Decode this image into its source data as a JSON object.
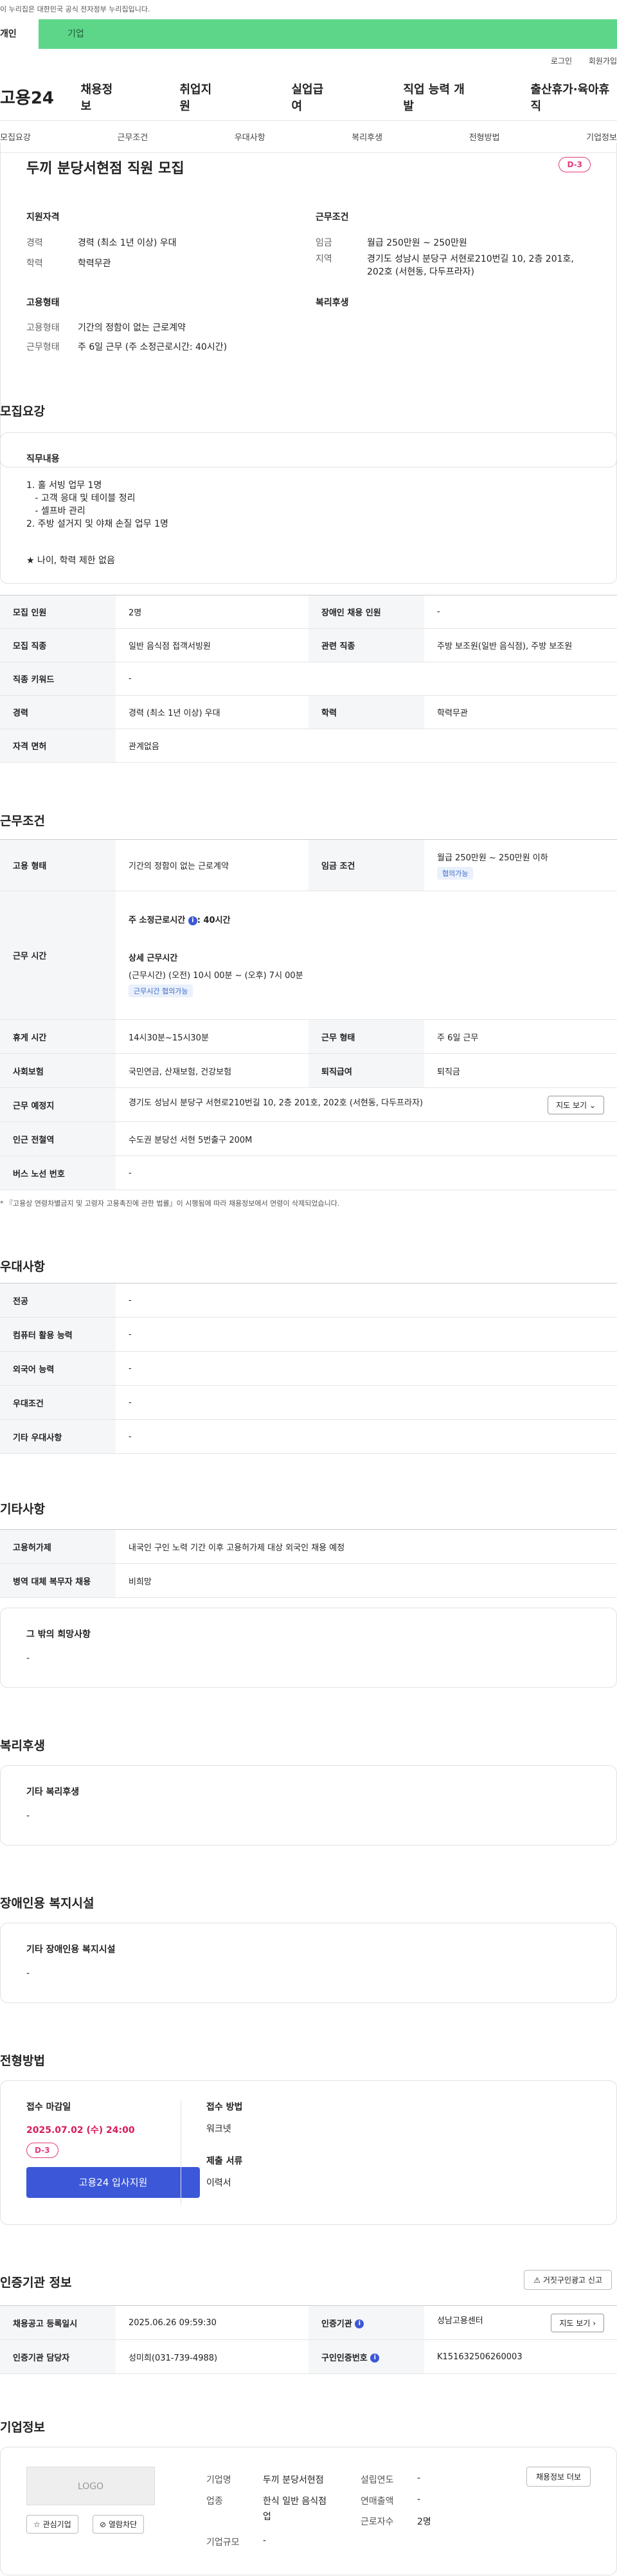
{
  "gov_banner": "이 누리집은 대한민국 공식 전자정부 누리집입니다.",
  "tabs": {
    "personal": "개인",
    "company": "기업"
  },
  "util": {
    "login": "로그인",
    "join": "회원가입"
  },
  "gnb": {
    "logo": "고용24",
    "items": [
      "채용정보",
      "취업지원",
      "실업급여",
      "직업 능력 개발",
      "출산휴가·육아휴직"
    ]
  },
  "subnav": [
    "모집요강",
    "근무조건",
    "우대사항",
    "복리후생",
    "전형방법",
    "기업정보"
  ],
  "job": {
    "title": "두끼 분당서현점 직원 모집",
    "dday": "D-3",
    "qual_head": "지원자격",
    "career_k": "경력",
    "career_v": "경력 (최소 1년 이상) 우대",
    "edu_k": "학력",
    "edu_v": "학력무관",
    "cond_head": "근무조건",
    "wage_k": "임금",
    "wage_v": "월급 250만원 ~ 250만원",
    "region_k": "지역",
    "region_v1": "경기도 성남시 분당구 서현로210번길 10, 2층 201호,",
    "region_v2": "202호 (서현동, 다두프라자)",
    "emp_head": "고용형태",
    "emp_k": "고용형태",
    "emp_v": "기간의 정함이 없는 근로계약",
    "work_k": "근무형태",
    "work_v": "주 6일 근무 (주 소정근로시간: 40시간)",
    "welfare_head": "복리후생"
  },
  "recruit": {
    "title": "모집요강",
    "duty_head": "직무내용",
    "duty_lines": [
      "1. 홀 서빙 업무 1명",
      "   - 고객 응대 및 테이블 정리",
      "   - 셀프바 관리",
      "2. 주방 설거지 및 야채 손질 업무 1명"
    ],
    "duty_note": "★ 나이, 학력 제한 없음",
    "rows": [
      {
        "k1": "모집 인원",
        "v1": "2명",
        "k2": "장애인 채용 인원",
        "v2": "-"
      },
      {
        "k1": "모집 직종",
        "v1": "일반 음식점 접객서빙원",
        "k2": "관련 직종",
        "v2": "주방 보조원(일반 음식점), 주방 보조원"
      },
      {
        "k1": "직종 키워드",
        "v1": "-"
      },
      {
        "k1": "경력",
        "v1": "경력 (최소 1년 이상) 우대",
        "k2": "학력",
        "v2": "학력무관"
      },
      {
        "k1": "자격 면허",
        "v1": "관계없음"
      }
    ]
  },
  "conditions": {
    "title": "근무조건",
    "emp_k": "고용 형태",
    "emp_v": "기간의 정함이 없는 근로계약",
    "wage_k": "임금 조건",
    "wage_v": "월급 250만원 ~ 250만원 이하",
    "wage_chip": "협의가능",
    "time_k": "근무 시간",
    "time_weekly": "주 소정근로시간 ",
    "time_weekly_v": ": 40시간",
    "time_detail_head": "상세 근무시간",
    "time_detail": "(근무시간) (오전) 10시 00분 ~ (오후) 7시 00분",
    "time_chip": "근무시간 협의가능",
    "rest_k": "휴게 시간",
    "rest_v": "14시30분~15시30분",
    "form_k": "근무 형태",
    "form_v": "주 6일 근무",
    "ins_k": "사회보험",
    "ins_v": "국민연금, 산재보험, 건강보험",
    "sev_k": "퇴직급여",
    "sev_v": "퇴직금",
    "place_k": "근무 예정지",
    "place_v": "경기도 성남시 분당구 서현로210번길 10, 2층 201호, 202호 (서현동, 다두프라자)",
    "map_btn": "지도 보기",
    "subway_k": "인근 전철역",
    "subway_v": "수도권 분당선 서현 5번출구 200M",
    "bus_k": "버스 노선 번호",
    "bus_v": "-",
    "note": "* 『고용상 연령차별금지 및 고령자 고용촉진에 관한 법률』이 시행됨에 따라 채용정보에서 연령이 삭제되었습니다."
  },
  "prefer": {
    "title": "우대사항",
    "rows": [
      {
        "k": "전공",
        "v": "-"
      },
      {
        "k": "컴퓨터 활용 능력",
        "v": "-"
      },
      {
        "k": "외국어 능력",
        "v": "-"
      },
      {
        "k": "우대조건",
        "v": "-"
      },
      {
        "k": "기타 우대사항",
        "v": "-"
      }
    ]
  },
  "etc": {
    "title": "기타사항",
    "hire_k": "고용허가제",
    "hire_v": "내국인 구인 노력 기간 이후 고용허가제 대상 외국인 채용 예정",
    "mil_k": "병역 대체 복무자 채용",
    "mil_v": "비희망",
    "other_head": "그 밖의 희망사항",
    "other_v": "-"
  },
  "welfare": {
    "title": "복리후생",
    "head": "기타 복리후생",
    "v": "-"
  },
  "disabled": {
    "title": "장애인용 복지시설",
    "head": "기타 장애인용 복지시설",
    "v": "-"
  },
  "process": {
    "title": "전형방법",
    "deadline_head": "접수 마감일",
    "deadline": "2025.07.02 (수) 24:00",
    "dday": "D-3",
    "apply_btn": "고용24 입사지원",
    "method_head": "접수 방법",
    "method_v": "워크넷",
    "docs_head": "제출 서류",
    "docs_v": "이력서"
  },
  "agency": {
    "title": "인증기관 정보",
    "report_btn": "거짓구인광고 신고",
    "date_k": "채용공고 등록일시",
    "date_v": "2025.06.26 09:59:30",
    "org_k": "인증기관",
    "org_v": "성남고용센터",
    "map_btn": "지도 보기",
    "mgr_k": "인증기관 담당자",
    "mgr_v": "성미희(031-739-4988)",
    "no_k": "구인인증번호",
    "no_v": "K151632506260003"
  },
  "company": {
    "title": "기업정보",
    "logo_text": "LOGO",
    "fav_btn": "관심기업",
    "block_btn": "열람차단",
    "name_k": "기업명",
    "name_v": "두끼 분당서현점",
    "ind_k": "업종",
    "ind_v1": "한식 일반 음식점",
    "ind_v2": "업",
    "size_k": "기업규모",
    "size_v": "-",
    "year_k": "설립연도",
    "year_v": "-",
    "sales_k": "연매출액",
    "sales_v": "-",
    "emp_k": "근로자수",
    "emp_v": "2명",
    "jobs_btn": "채용정보 더보"
  }
}
